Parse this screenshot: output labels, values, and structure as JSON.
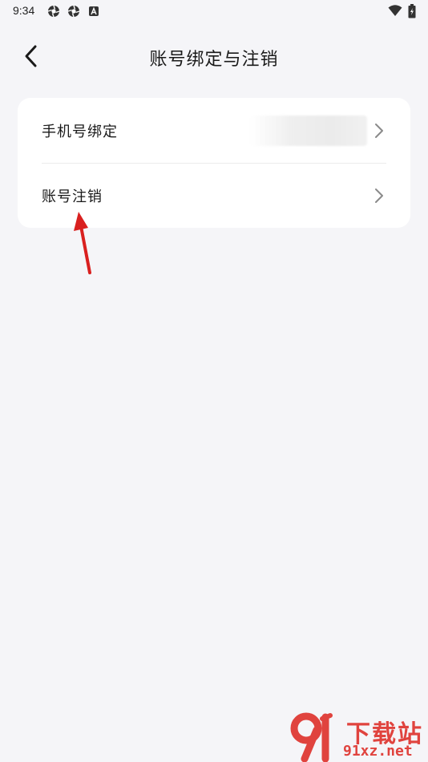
{
  "status_bar": {
    "time": "9:34",
    "left_icons": [
      "aperture-icon",
      "aperture-icon",
      "app-a-icon"
    ],
    "right_icons": [
      "wifi-icon",
      "battery-charging-icon"
    ]
  },
  "header": {
    "title": "账号绑定与注销",
    "back_icon": "chevron-left-icon"
  },
  "settings": {
    "items": [
      {
        "label": "手机号绑定",
        "value_blurred": true,
        "icon": "chevron-right-icon"
      },
      {
        "label": "账号注销",
        "icon": "chevron-right-icon"
      }
    ]
  },
  "annotation": {
    "arrow_color": "#d9201f"
  },
  "watermark": {
    "logo_text": "91",
    "site_name": "下载站",
    "domain": "91xz.net",
    "color": "#e0433e"
  },
  "colors": {
    "background": "#f5f5f8",
    "card": "#ffffff",
    "text": "#1a1a1a"
  }
}
